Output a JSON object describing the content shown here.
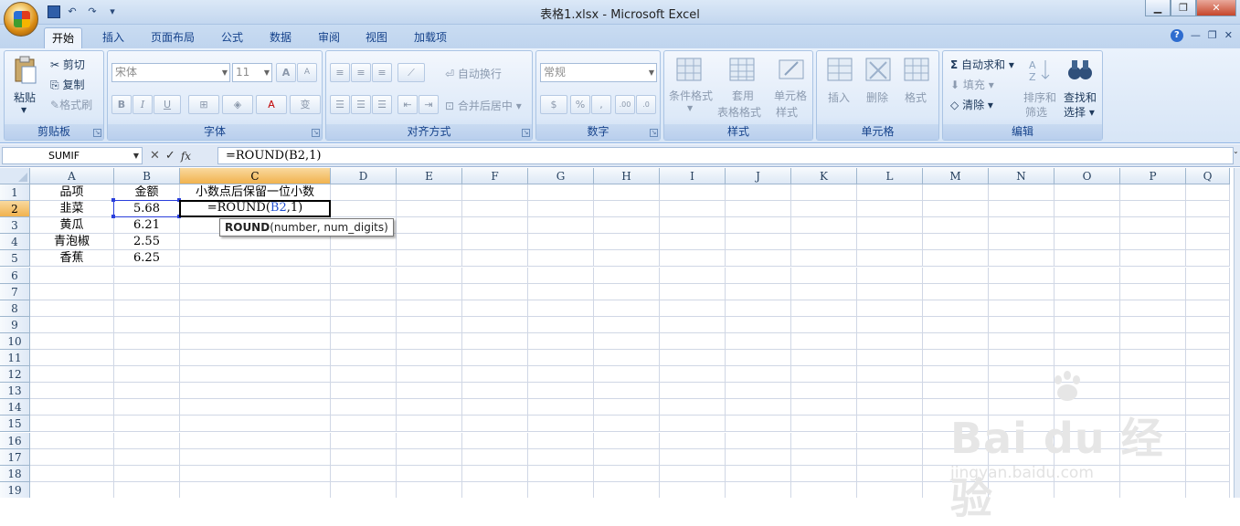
{
  "window": {
    "title": "表格1.xlsx - Microsoft Excel",
    "min_label": "▁",
    "max_label": "❐",
    "close_label": "✕"
  },
  "qat": {
    "undo": "↶",
    "redo": "↷",
    "customize": "▾"
  },
  "tabs": [
    "开始",
    "插入",
    "页面布局",
    "公式",
    "数据",
    "审阅",
    "视图",
    "加载项"
  ],
  "active_tab": "开始",
  "tabs_right": {
    "help": "?",
    "min": "—",
    "restore": "❐",
    "close": "✕"
  },
  "ribbon": {
    "clipboard": {
      "label": "剪贴板",
      "paste": "粘贴",
      "cut": "剪切",
      "copy": "复制",
      "painter": "格式刷"
    },
    "font": {
      "label": "字体",
      "font_name": "宋体",
      "font_size": "11",
      "bold": "B",
      "italic": "I",
      "underline": "U",
      "grow": "A",
      "shrink": "A",
      "wen": "变"
    },
    "alignment": {
      "label": "对齐方式",
      "wrap": "自动换行",
      "merge": "合并后居中"
    },
    "number": {
      "label": "数字",
      "format": "常规",
      "percent": "%",
      "comma": ",",
      "inc": ".00",
      "dec": ".0"
    },
    "styles": {
      "label": "样式",
      "cond1": "条件格式",
      "table1": "套用",
      "table2": "表格格式",
      "cell1": "单元格",
      "cell2": "样式"
    },
    "cells": {
      "label": "单元格",
      "insert": "插入",
      "delete": "删除",
      "format": "格式"
    },
    "editing": {
      "label": "编辑",
      "autosum": "自动求和",
      "fill": "填充",
      "clear": "清除",
      "sort1": "排序和",
      "sort2": "筛选",
      "find1": "查找和",
      "find2": "选择"
    }
  },
  "formula_bar": {
    "name_box": "SUMIF",
    "cancel": "✕",
    "enter": "✓",
    "fx": "fx",
    "formula": "=ROUND(B2,1)"
  },
  "sheet": {
    "columns": [
      "A",
      "B",
      "C",
      "D",
      "E",
      "F",
      "G",
      "H",
      "I",
      "J",
      "K",
      "L",
      "M",
      "N",
      "O",
      "P",
      "Q"
    ],
    "rows": [
      "1",
      "2",
      "3",
      "4",
      "5",
      "6",
      "7",
      "8",
      "9",
      "10",
      "11",
      "12",
      "13",
      "14",
      "15",
      "16",
      "17",
      "18",
      "19"
    ],
    "cells": {
      "A1": "品项",
      "B1": "金额",
      "C1": "小数点后保留一位小数",
      "A2": "韭菜",
      "B2": "5.68",
      "A3": "黄瓜",
      "B3": "6.21",
      "A4": "青泡椒",
      "B4": "2.55",
      "A5": "香蕉",
      "B5": "6.25"
    },
    "active_cell_prefix": "=ROUND(",
    "active_cell_ref": "B2",
    "active_cell_suffix": ",1)",
    "tooltip_fn": "ROUND",
    "tooltip_args": "(number, num_digits)"
  },
  "watermark": {
    "brand": "Bai du 经验",
    "url": "jingyan.baidu.com"
  }
}
